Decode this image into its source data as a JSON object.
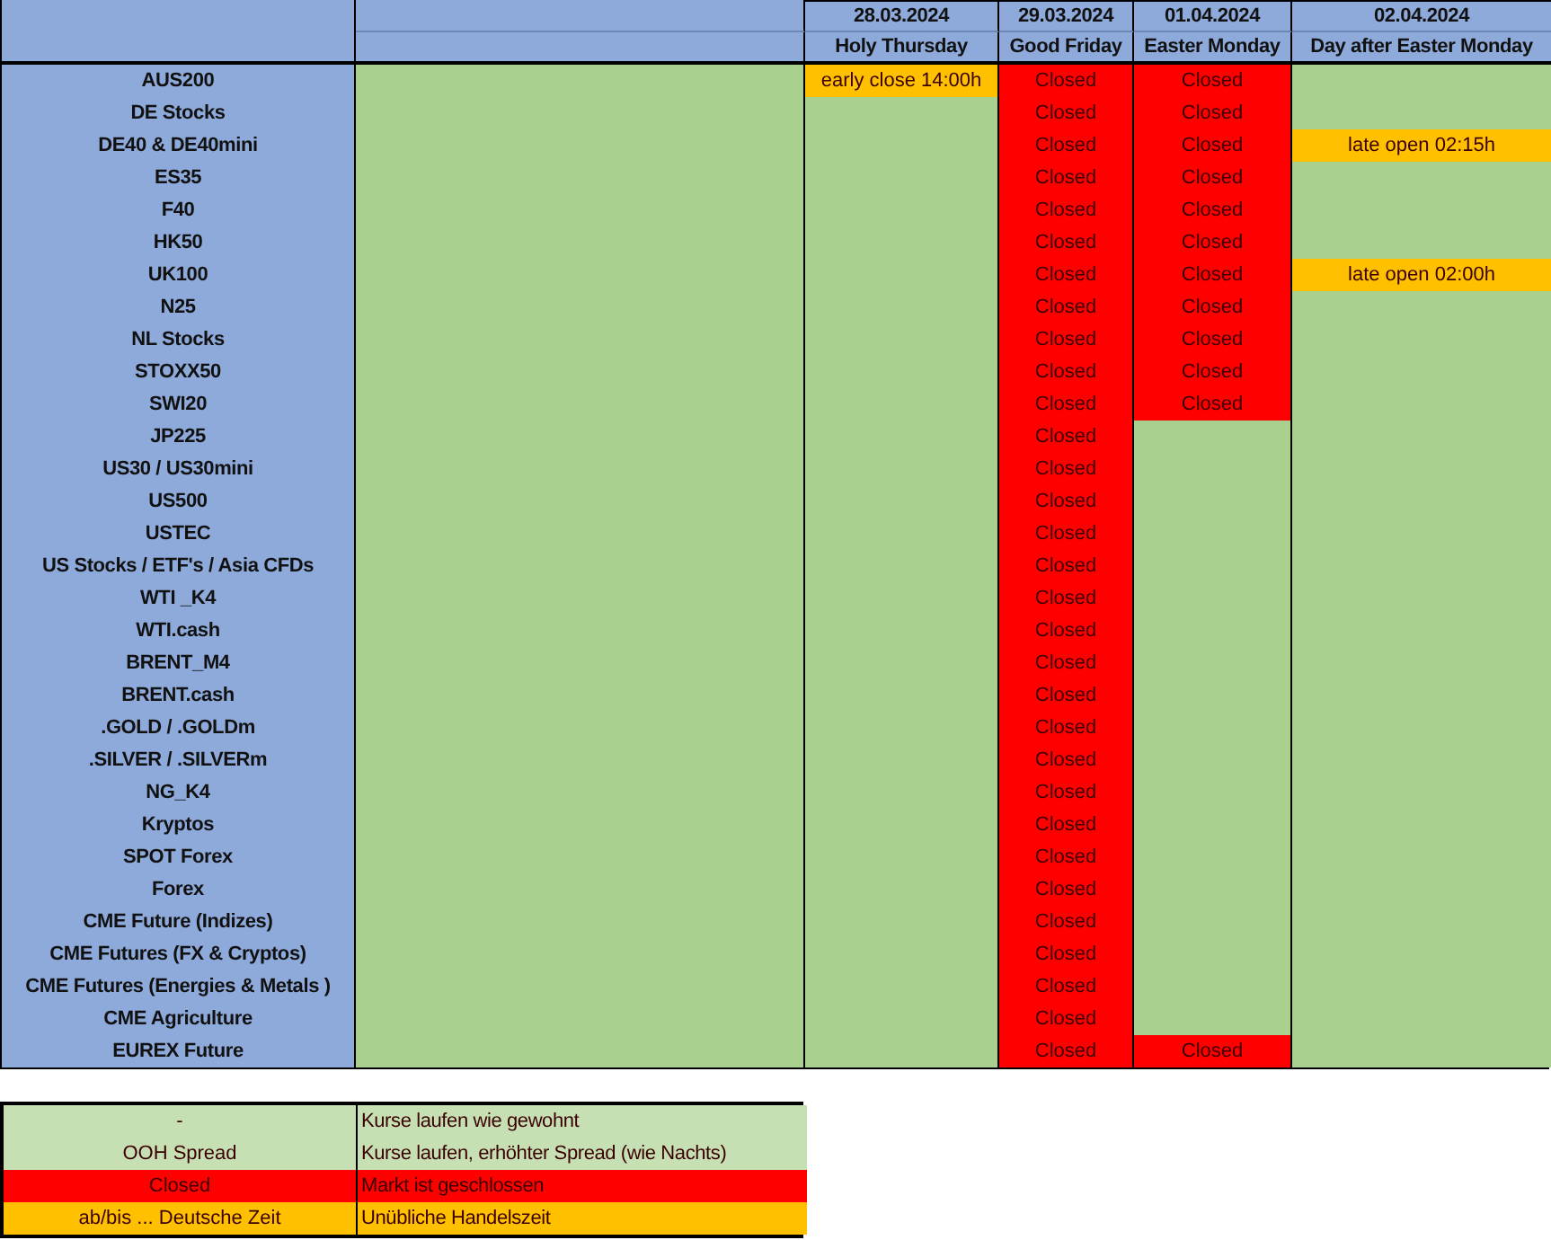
{
  "table": {
    "columns": [
      {
        "date": "28.03.2024",
        "day": "Holy Thursday"
      },
      {
        "date": "29.03.2024",
        "day": "Good Friday"
      },
      {
        "date": "01.04.2024",
        "day": "Easter Monday"
      },
      {
        "date": "02.04.2024",
        "day": "Day after Easter Monday"
      }
    ],
    "rows": [
      {
        "name": "AUS200",
        "cells": [
          {
            "color": "#ffc000",
            "text": "early close 14:00h"
          },
          {
            "color": "#ff0000",
            "text": "Closed"
          },
          {
            "color": "#ff0000",
            "text": "Closed"
          },
          {
            "color": "#a9d08e"
          }
        ]
      },
      {
        "name": "DE Stocks",
        "cells": [
          {
            "color": "#a9d08e"
          },
          {
            "color": "#ff0000",
            "text": "Closed"
          },
          {
            "color": "#ff0000",
            "text": "Closed"
          },
          {
            "color": "#a9d08e"
          }
        ]
      },
      {
        "name": "DE40 & DE40mini",
        "cells": [
          {
            "color": "#a9d08e"
          },
          {
            "color": "#ff0000",
            "text": "Closed"
          },
          {
            "color": "#ff0000",
            "text": "Closed"
          },
          {
            "color": "#ffc000",
            "text": "late open 02:15h"
          }
        ]
      },
      {
        "name": "ES35",
        "cells": [
          {
            "color": "#a9d08e"
          },
          {
            "color": "#ff0000",
            "text": "Closed"
          },
          {
            "color": "#ff0000",
            "text": "Closed"
          },
          {
            "color": "#a9d08e"
          }
        ]
      },
      {
        "name": "F40",
        "cells": [
          {
            "color": "#a9d08e"
          },
          {
            "color": "#ff0000",
            "text": "Closed"
          },
          {
            "color": "#ff0000",
            "text": "Closed"
          },
          {
            "color": "#a9d08e"
          }
        ]
      },
      {
        "name": "HK50",
        "cells": [
          {
            "color": "#a9d08e"
          },
          {
            "color": "#ff0000",
            "text": "Closed"
          },
          {
            "color": "#ff0000",
            "text": "Closed"
          },
          {
            "color": "#a9d08e"
          }
        ]
      },
      {
        "name": "UK100",
        "cells": [
          {
            "color": "#a9d08e"
          },
          {
            "color": "#ff0000",
            "text": "Closed"
          },
          {
            "color": "#ff0000",
            "text": "Closed"
          },
          {
            "color": "#ffc000",
            "text": "late open 02:00h"
          }
        ]
      },
      {
        "name": "N25",
        "cells": [
          {
            "color": "#a9d08e"
          },
          {
            "color": "#ff0000",
            "text": "Closed"
          },
          {
            "color": "#ff0000",
            "text": "Closed"
          },
          {
            "color": "#a9d08e"
          }
        ]
      },
      {
        "name": "NL Stocks",
        "cells": [
          {
            "color": "#a9d08e"
          },
          {
            "color": "#ff0000",
            "text": "Closed"
          },
          {
            "color": "#ff0000",
            "text": "Closed"
          },
          {
            "color": "#a9d08e"
          }
        ]
      },
      {
        "name": "STOXX50",
        "cells": [
          {
            "color": "#a9d08e"
          },
          {
            "color": "#ff0000",
            "text": "Closed"
          },
          {
            "color": "#ff0000",
            "text": "Closed"
          },
          {
            "color": "#a9d08e"
          }
        ]
      },
      {
        "name": "SWI20",
        "cells": [
          {
            "color": "#a9d08e"
          },
          {
            "color": "#ff0000",
            "text": "Closed"
          },
          {
            "color": "#ff0000",
            "text": "Closed"
          },
          {
            "color": "#a9d08e"
          }
        ]
      },
      {
        "name": "JP225",
        "cells": [
          {
            "color": "#a9d08e"
          },
          {
            "color": "#ff0000",
            "text": "Closed"
          },
          {
            "color": "#a9d08e"
          },
          {
            "color": "#a9d08e"
          }
        ]
      },
      {
        "name": "US30 / US30mini",
        "cells": [
          {
            "color": "#a9d08e"
          },
          {
            "color": "#ff0000",
            "text": "Closed"
          },
          {
            "color": "#a9d08e"
          },
          {
            "color": "#a9d08e"
          }
        ]
      },
      {
        "name": "US500",
        "cells": [
          {
            "color": "#a9d08e"
          },
          {
            "color": "#ff0000",
            "text": "Closed"
          },
          {
            "color": "#a9d08e"
          },
          {
            "color": "#a9d08e"
          }
        ]
      },
      {
        "name": "USTEC",
        "cells": [
          {
            "color": "#a9d08e"
          },
          {
            "color": "#ff0000",
            "text": "Closed"
          },
          {
            "color": "#a9d08e"
          },
          {
            "color": "#a9d08e"
          }
        ]
      },
      {
        "name": "US Stocks / ETF's / Asia CFDs",
        "cells": [
          {
            "color": "#a9d08e"
          },
          {
            "color": "#ff0000",
            "text": "Closed"
          },
          {
            "color": "#a9d08e"
          },
          {
            "color": "#a9d08e"
          }
        ]
      },
      {
        "name": "WTI _K4",
        "cells": [
          {
            "color": "#a9d08e"
          },
          {
            "color": "#ff0000",
            "text": "Closed"
          },
          {
            "color": "#a9d08e"
          },
          {
            "color": "#a9d08e"
          }
        ]
      },
      {
        "name": "WTI.cash",
        "cells": [
          {
            "color": "#a9d08e"
          },
          {
            "color": "#ff0000",
            "text": "Closed"
          },
          {
            "color": "#a9d08e"
          },
          {
            "color": "#a9d08e"
          }
        ]
      },
      {
        "name": "BRENT_M4",
        "cells": [
          {
            "color": "#a9d08e"
          },
          {
            "color": "#ff0000",
            "text": "Closed"
          },
          {
            "color": "#a9d08e"
          },
          {
            "color": "#a9d08e"
          }
        ]
      },
      {
        "name": "BRENT.cash",
        "cells": [
          {
            "color": "#a9d08e"
          },
          {
            "color": "#ff0000",
            "text": "Closed"
          },
          {
            "color": "#a9d08e"
          },
          {
            "color": "#a9d08e"
          }
        ]
      },
      {
        "name": ".GOLD / .GOLDm",
        "cells": [
          {
            "color": "#a9d08e"
          },
          {
            "color": "#ff0000",
            "text": "Closed"
          },
          {
            "color": "#a9d08e"
          },
          {
            "color": "#a9d08e"
          }
        ]
      },
      {
        "name": ".SILVER / .SILVERm",
        "cells": [
          {
            "color": "#a9d08e"
          },
          {
            "color": "#ff0000",
            "text": "Closed"
          },
          {
            "color": "#a9d08e"
          },
          {
            "color": "#a9d08e"
          }
        ]
      },
      {
        "name": "NG_K4",
        "cells": [
          {
            "color": "#a9d08e"
          },
          {
            "color": "#ff0000",
            "text": "Closed"
          },
          {
            "color": "#a9d08e"
          },
          {
            "color": "#a9d08e"
          }
        ]
      },
      {
        "name": "Kryptos",
        "cells": [
          {
            "color": "#a9d08e"
          },
          {
            "color": "#ff0000",
            "text": "Closed"
          },
          {
            "color": "#a9d08e"
          },
          {
            "color": "#a9d08e"
          }
        ]
      },
      {
        "name": "SPOT Forex",
        "cells": [
          {
            "color": "#a9d08e"
          },
          {
            "color": "#ff0000",
            "text": "Closed"
          },
          {
            "color": "#a9d08e"
          },
          {
            "color": "#a9d08e"
          }
        ]
      },
      {
        "name": "Forex",
        "cells": [
          {
            "color": "#a9d08e"
          },
          {
            "color": "#ff0000",
            "text": "Closed"
          },
          {
            "color": "#a9d08e"
          },
          {
            "color": "#a9d08e"
          }
        ]
      },
      {
        "name": "CME Future (Indizes)",
        "cells": [
          {
            "color": "#a9d08e"
          },
          {
            "color": "#ff0000",
            "text": "Closed"
          },
          {
            "color": "#a9d08e"
          },
          {
            "color": "#a9d08e"
          }
        ]
      },
      {
        "name": "CME Futures (FX & Cryptos)",
        "cells": [
          {
            "color": "#a9d08e"
          },
          {
            "color": "#ff0000",
            "text": "Closed"
          },
          {
            "color": "#a9d08e"
          },
          {
            "color": "#a9d08e"
          }
        ]
      },
      {
        "name": "CME Futures (Energies & Metals )",
        "cells": [
          {
            "color": "#a9d08e"
          },
          {
            "color": "#ff0000",
            "text": "Closed"
          },
          {
            "color": "#a9d08e"
          },
          {
            "color": "#a9d08e"
          }
        ]
      },
      {
        "name": "CME Agriculture",
        "cells": [
          {
            "color": "#a9d08e"
          },
          {
            "color": "#ff0000",
            "text": "Closed"
          },
          {
            "color": "#a9d08e"
          },
          {
            "color": "#a9d08e"
          }
        ]
      },
      {
        "name": "EUREX Future",
        "cells": [
          {
            "color": "#a9d08e"
          },
          {
            "color": "#ff0000",
            "text": "Closed"
          },
          {
            "color": "#ff0000",
            "text": "Closed"
          },
          {
            "color": "#a9d08e"
          }
        ]
      }
    ]
  },
  "legend": [
    {
      "color": "#c6e0b4",
      "symbol": "-",
      "meaning": "Kurse laufen wie gewohnt"
    },
    {
      "color": "#c6e0b4",
      "symbol": "OOH Spread",
      "meaning": "Kurse laufen, erhöhter Spread (wie Nachts)"
    },
    {
      "color": "#ff0000",
      "symbol": "Closed",
      "meaning": "Markt ist geschlossen"
    },
    {
      "color": "#ffc000",
      "symbol": "ab/bis ... Deutsche Zeit",
      "meaning": "Unübliche Handelszeit"
    }
  ]
}
